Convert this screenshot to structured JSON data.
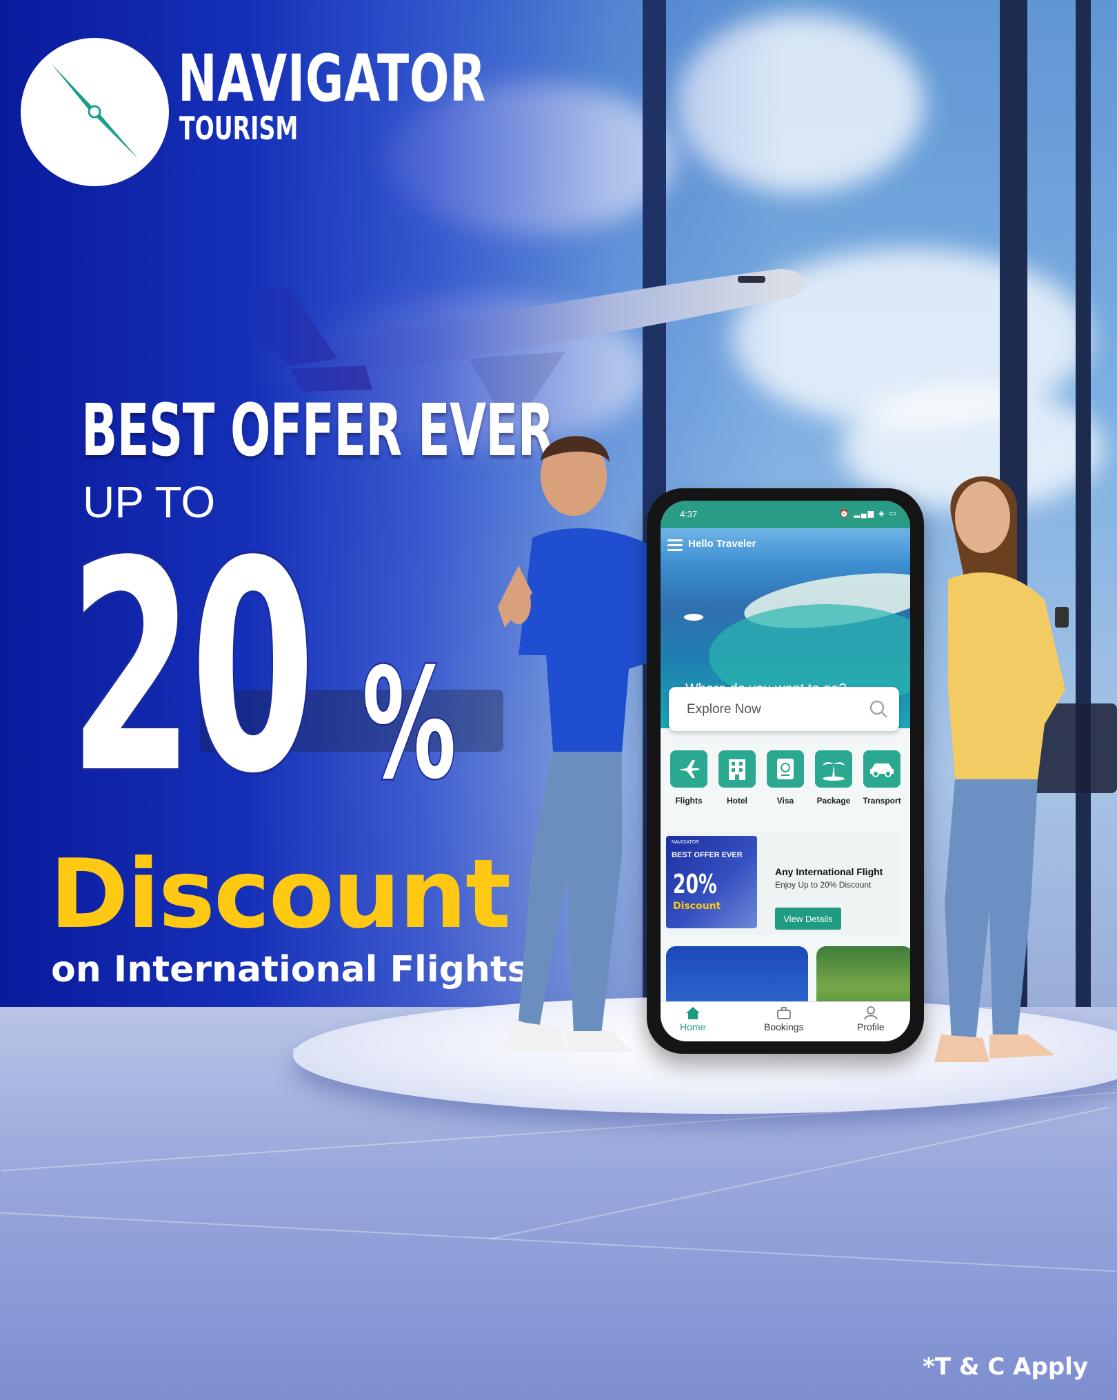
{
  "brand": {
    "name": "NAVIGATOR",
    "sub": "TOURISM"
  },
  "headline": {
    "line1": "BEST OFFER EVER",
    "line2": "UP TO",
    "number": "20",
    "percent": "%",
    "discount": "Discount",
    "subline": "on International Flights"
  },
  "footnote": "*T & C Apply",
  "colors": {
    "primary_blue": "#1530b8",
    "accent_yellow": "#ffc812",
    "app_teal": "#2aa890"
  },
  "phone": {
    "status_time": "4:37",
    "greeting": "Hello Traveler",
    "prompt": "Where do you want to go?",
    "search_placeholder": "Explore Now",
    "categories": [
      {
        "label": "Flights",
        "icon": "airplane-icon"
      },
      {
        "label": "Hotel",
        "icon": "hotel-icon"
      },
      {
        "label": "Visa",
        "icon": "passport-icon"
      },
      {
        "label": "Package",
        "icon": "island-icon"
      },
      {
        "label": "Transport",
        "icon": "car-icon"
      }
    ],
    "promo": {
      "title": "Any International Flight",
      "subtitle": "Enjoy Up to 20% Discount",
      "button": "View Details",
      "thumb_brand": "NAVIGATOR",
      "thumb_title": "BEST OFFER EVER",
      "thumb_number": "20%",
      "thumb_discount": "Discount"
    },
    "tabs": [
      {
        "label": "Home",
        "icon": "home-icon",
        "active": true
      },
      {
        "label": "Bookings",
        "icon": "briefcase-icon",
        "active": false
      },
      {
        "label": "Profile",
        "icon": "user-icon",
        "active": false
      }
    ]
  }
}
